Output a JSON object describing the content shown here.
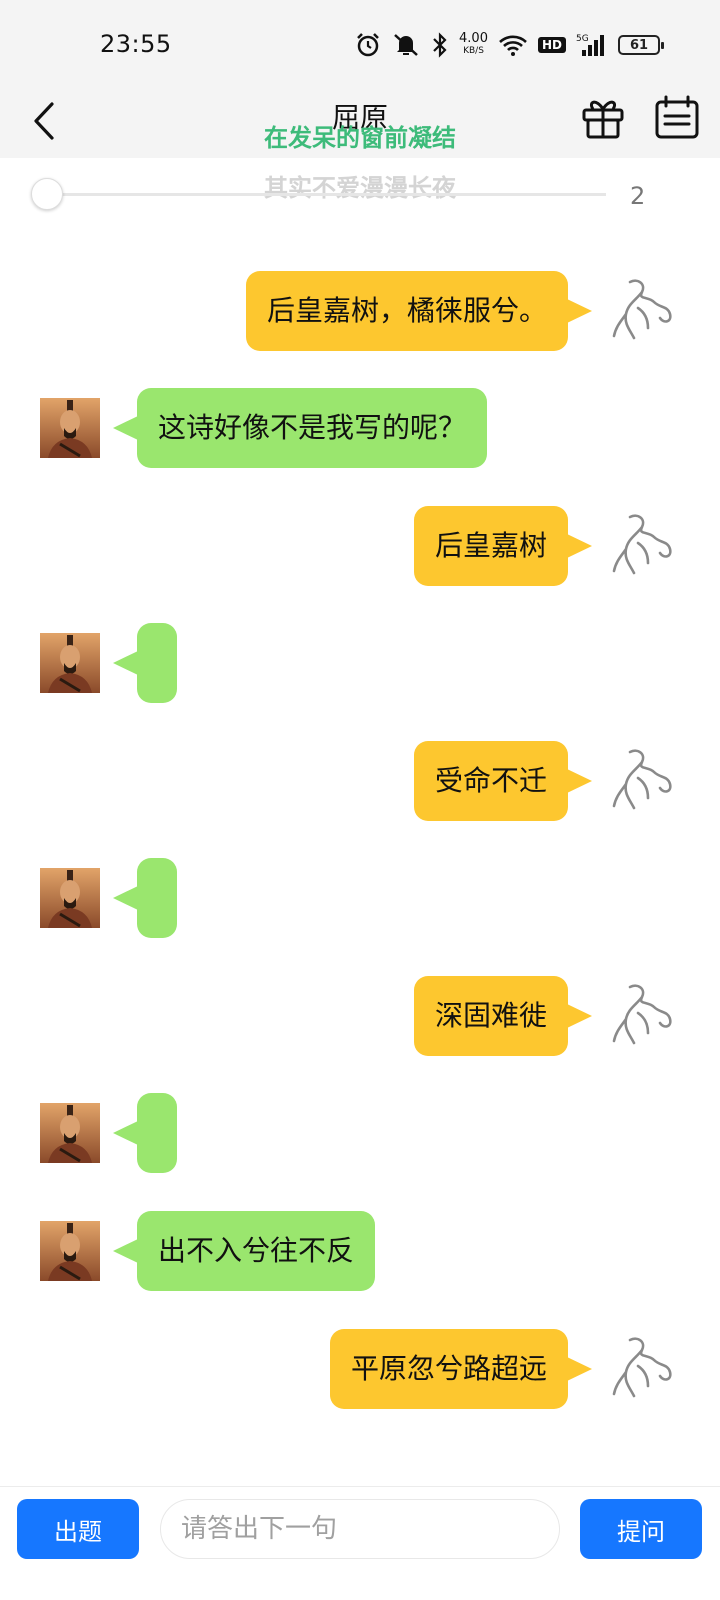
{
  "status_bar": {
    "time": "23:55",
    "icons": [
      "alarm-icon",
      "mute-icon",
      "bluetooth-icon",
      "wifi-icon",
      "signal-icon"
    ],
    "speed_value": "4.00",
    "speed_unit": "KB/S",
    "hd_label": "HD",
    "network_label": "5G",
    "battery": "61"
  },
  "header": {
    "title": "屈原",
    "overlay_line1": "在发呆的窗前凝结",
    "overlay_line2": "其实不爱漫漫长夜",
    "progress_count": "2",
    "progress_fraction": 0
  },
  "messages": [
    {
      "role": "user",
      "text": "后皇嘉树，橘徕服兮。"
    },
    {
      "role": "bot",
      "text": "这诗好像不是我写的呢？"
    },
    {
      "role": "user",
      "text": "后皇嘉树"
    },
    {
      "role": "bot",
      "text": ""
    },
    {
      "role": "user",
      "text": "受命不迁"
    },
    {
      "role": "bot",
      "text": ""
    },
    {
      "role": "user",
      "text": "深固难徙"
    },
    {
      "role": "bot",
      "text": ""
    },
    {
      "role": "bot",
      "text": "出不入兮往不反"
    },
    {
      "role": "user",
      "text": "平原忽兮路超远"
    }
  ],
  "bottom_bar": {
    "ask_button": "出题",
    "input_placeholder": "请答出下一句",
    "input_value": "",
    "submit_button": "提问"
  },
  "colors": {
    "user_bubble": "#fdc72f",
    "bot_bubble": "#9ae66e",
    "primary_button": "#1677ff",
    "overlay_text": "#3dbb7a"
  }
}
